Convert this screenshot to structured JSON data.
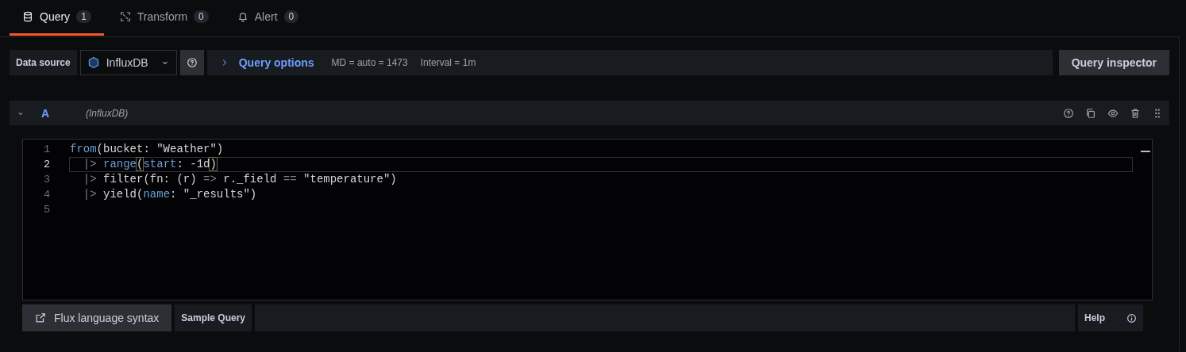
{
  "tabs": [
    {
      "label": "Query",
      "count": "1",
      "selected": true
    },
    {
      "label": "Transform",
      "count": "0",
      "selected": false
    },
    {
      "label": "Alert",
      "count": "0",
      "selected": false
    }
  ],
  "toolbar": {
    "data_source_label": "Data source",
    "data_source": "InfluxDB",
    "query_options": "Query options",
    "max_data_points": "MD = auto = 1473",
    "interval": "Interval = 1m",
    "inspector_button": "Query inspector"
  },
  "query": {
    "name": "A",
    "datasource": "(InfluxDB)",
    "expanded": true
  },
  "editor": {
    "lines": [
      {
        "number": "1",
        "active": false,
        "tokens": [
          {
            "text": "from",
            "kind": "keyword"
          },
          {
            "text": "(bucket: \"Weather\")",
            "kind": "plain"
          }
        ]
      },
      {
        "number": "2",
        "active": true,
        "tokens": [
          {
            "text": "  |> ",
            "kind": "operator"
          },
          {
            "text": "range",
            "kind": "keyword"
          },
          {
            "text": "(",
            "kind": "match"
          },
          {
            "text": "start",
            "kind": "keyword"
          },
          {
            "text": ": -1d",
            "kind": "plain"
          },
          {
            "text": ")",
            "kind": "match"
          }
        ]
      },
      {
        "number": "3",
        "active": false,
        "tokens": [
          {
            "text": "  |>",
            "kind": "operator"
          },
          {
            "text": " filter(fn: (r) ",
            "kind": "plain"
          },
          {
            "text": "=>",
            "kind": "operator"
          },
          {
            "text": " r._field ",
            "kind": "plain"
          },
          {
            "text": "==",
            "kind": "operator"
          },
          {
            "text": " \"temperature\")",
            "kind": "plain"
          }
        ]
      },
      {
        "number": "4",
        "active": false,
        "tokens": [
          {
            "text": "  |>",
            "kind": "operator"
          },
          {
            "text": " yield(",
            "kind": "plain"
          },
          {
            "text": "name",
            "kind": "keyword"
          },
          {
            "text": ": \"_results\")",
            "kind": "plain"
          }
        ]
      },
      {
        "number": "5",
        "active": false
      }
    ]
  },
  "footer": {
    "syntax_link": "Flux language syntax",
    "sample_query": "Sample Query",
    "help": "Help"
  }
}
